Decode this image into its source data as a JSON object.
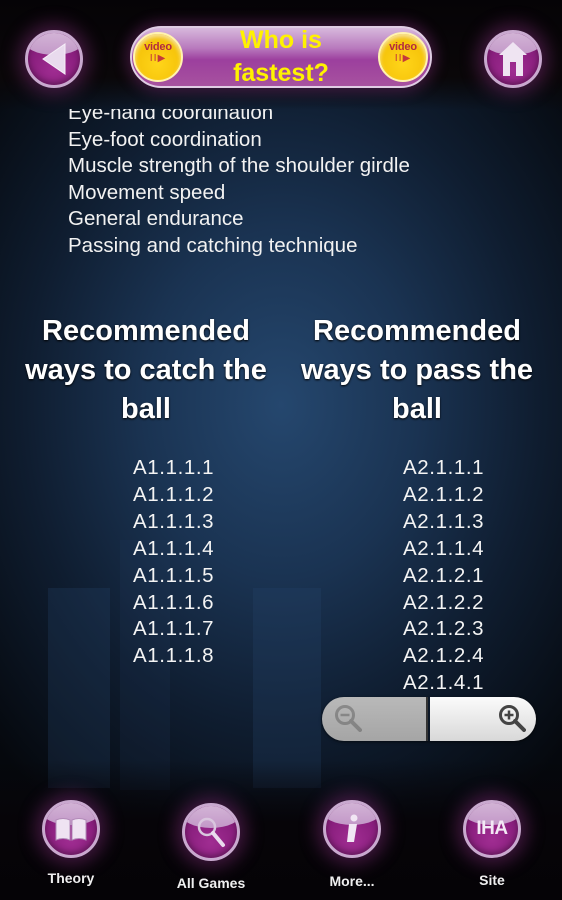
{
  "header": {
    "title": "Who is fastest?",
    "back_button": "back-arrow-icon",
    "home_button": "home-icon",
    "video_button_label": "video",
    "video_play_glyph": "II▶"
  },
  "skills": [
    "Eye-hand coordination",
    "Eye-foot coordination",
    "Muscle strength of the shoulder girdle",
    "Movement speed",
    "General endurance",
    "Passing and catching technique"
  ],
  "columns": {
    "catch": {
      "heading": "Recommended ways to catch the ball",
      "codes": [
        "A1.1.1.1",
        "A1.1.1.2",
        "A1.1.1.3",
        "A1.1.1.4",
        "A1.1.1.5",
        "A1.1.1.6",
        "A1.1.1.7",
        "A1.1.1.8"
      ]
    },
    "pass": {
      "heading": "Recommended ways to pass the ball",
      "codes": [
        "A2.1.1.1",
        "A2.1.1.2",
        "A2.1.1.3",
        "A2.1.1.4",
        "A2.1.2.1",
        "A2.1.2.2",
        "A2.1.2.3",
        "A2.1.2.4",
        "A2.1.4.1"
      ]
    }
  },
  "zoom_controls": {
    "zoom_out": "zoom-out-icon",
    "zoom_in": "zoom-in-icon"
  },
  "bottom_nav": [
    {
      "label": "Theory",
      "icon": "book-icon"
    },
    {
      "label": "All Games",
      "icon": "magnifier-icon"
    },
    {
      "label": "More...",
      "icon": "info-icon"
    },
    {
      "label": "Site",
      "icon": "iha-logo-icon",
      "icon_text": "IHA"
    }
  ],
  "colors": {
    "title_yellow": "#fff200",
    "button_purple": "#8a1f7e",
    "video_yellow": "#f6c40a"
  }
}
